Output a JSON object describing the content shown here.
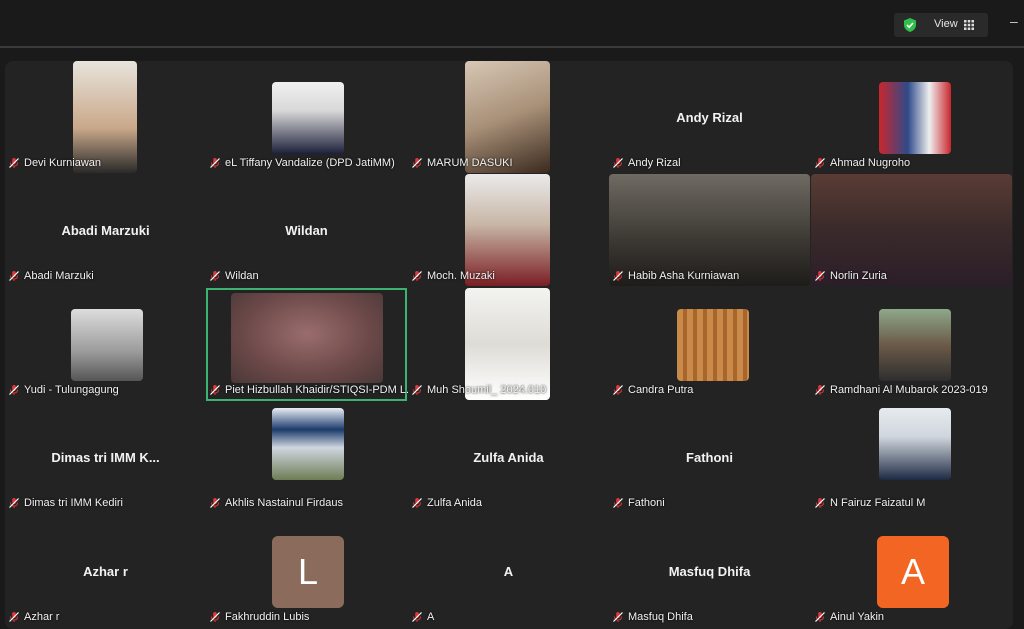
{
  "toolbar": {
    "view_label": "View",
    "minimize": "–"
  },
  "participants": [
    {
      "name": "Devi Kurniawan",
      "display": "video"
    },
    {
      "name": "eL Tiffany Vandalize (DPD JatiMM)",
      "display": "photo"
    },
    {
      "name": "MARUM DASUKI",
      "display": "video"
    },
    {
      "name": "Andy Rizal",
      "display": "name",
      "center": "Andy Rizal"
    },
    {
      "name": "Ahmad Nugroho",
      "display": "photo"
    },
    {
      "name": "Abadi Marzuki",
      "display": "name",
      "center": "Abadi Marzuki"
    },
    {
      "name": "Wildan",
      "display": "name",
      "center": "Wildan"
    },
    {
      "name": "Moch. Muzaki",
      "display": "video"
    },
    {
      "name": "Habib Asha Kurniawan",
      "display": "video"
    },
    {
      "name": "Norlin Zuria",
      "display": "video"
    },
    {
      "name": "Yudi - Tulungagung",
      "display": "photo"
    },
    {
      "name": "Piet Hizbullah Khaidir/STIQSI-PDM L...",
      "display": "video",
      "active": true
    },
    {
      "name": "Muh Shoumil_ 2024.010",
      "display": "video"
    },
    {
      "name": "Candra Putra",
      "display": "photo"
    },
    {
      "name": "Ramdhani Al Mubarok 2023-019",
      "display": "photo"
    },
    {
      "name": "Dimas tri IMM Kediri",
      "display": "name",
      "center": "Dimas tri IMM K..."
    },
    {
      "name": "Akhlis Nastainul Firdaus",
      "display": "photo"
    },
    {
      "name": "Zulfa Anida",
      "display": "name",
      "center": "Zulfa Anida"
    },
    {
      "name": "Fathoni",
      "display": "name",
      "center": "Fathoni"
    },
    {
      "name": "N Fairuz Faizatul M",
      "display": "photo"
    },
    {
      "name": "Azhar r",
      "display": "name",
      "center": "Azhar r"
    },
    {
      "name": "Fakhruddin Lubis",
      "display": "letter",
      "letter": "L"
    },
    {
      "name": "A",
      "display": "name",
      "center": "A"
    },
    {
      "name": "Masfuq Dhifa",
      "display": "name",
      "center": "Masfuq Dhifa"
    },
    {
      "name": "Ainul Yakin",
      "display": "letter",
      "letter": "A"
    }
  ],
  "colors": {
    "active_speaker": "#3cb371",
    "letter_L": "#8b6b5c",
    "letter_A": "#f26522",
    "muted_icon": "#e0363a"
  }
}
